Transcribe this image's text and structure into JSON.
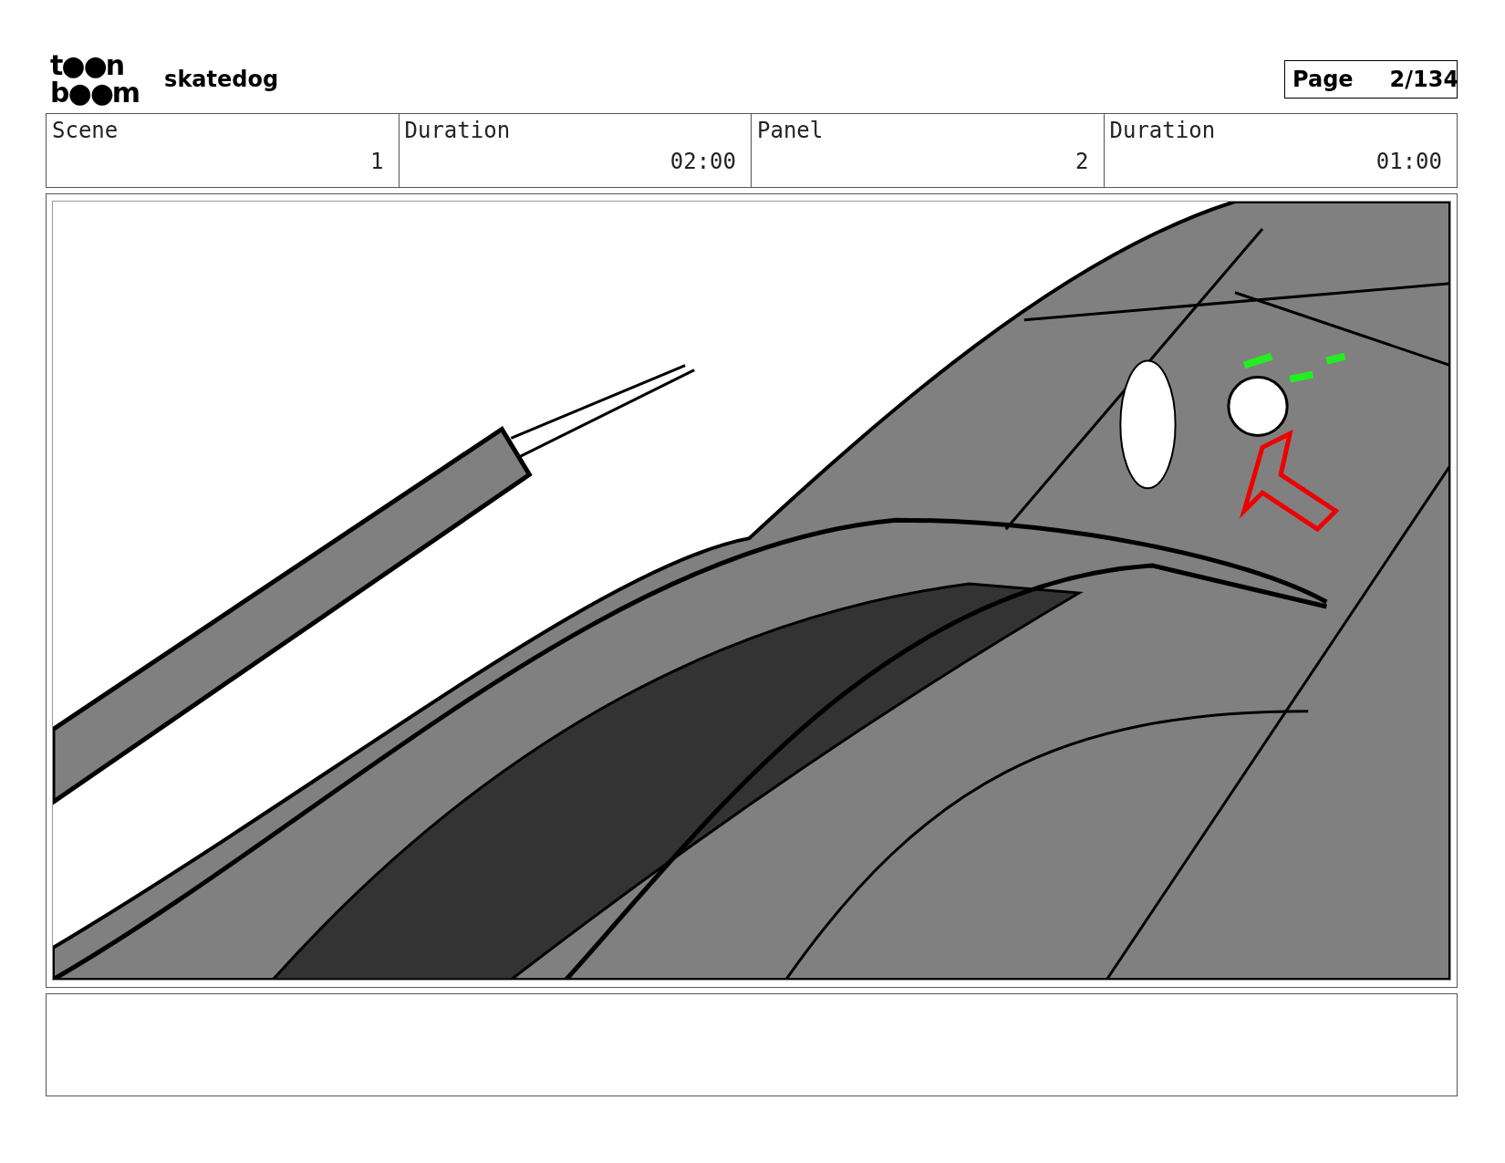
{
  "header": {
    "logo": [
      "t●●n",
      "b●●m"
    ],
    "project": "skatedog",
    "page_label": "Page",
    "page_number": "2/134"
  },
  "info": [
    {
      "label": "Scene",
      "value": "1"
    },
    {
      "label": "Duration",
      "value": "02:00"
    },
    {
      "label": "Panel",
      "value": "2"
    },
    {
      "label": "Duration",
      "value": "01:00"
    }
  ]
}
